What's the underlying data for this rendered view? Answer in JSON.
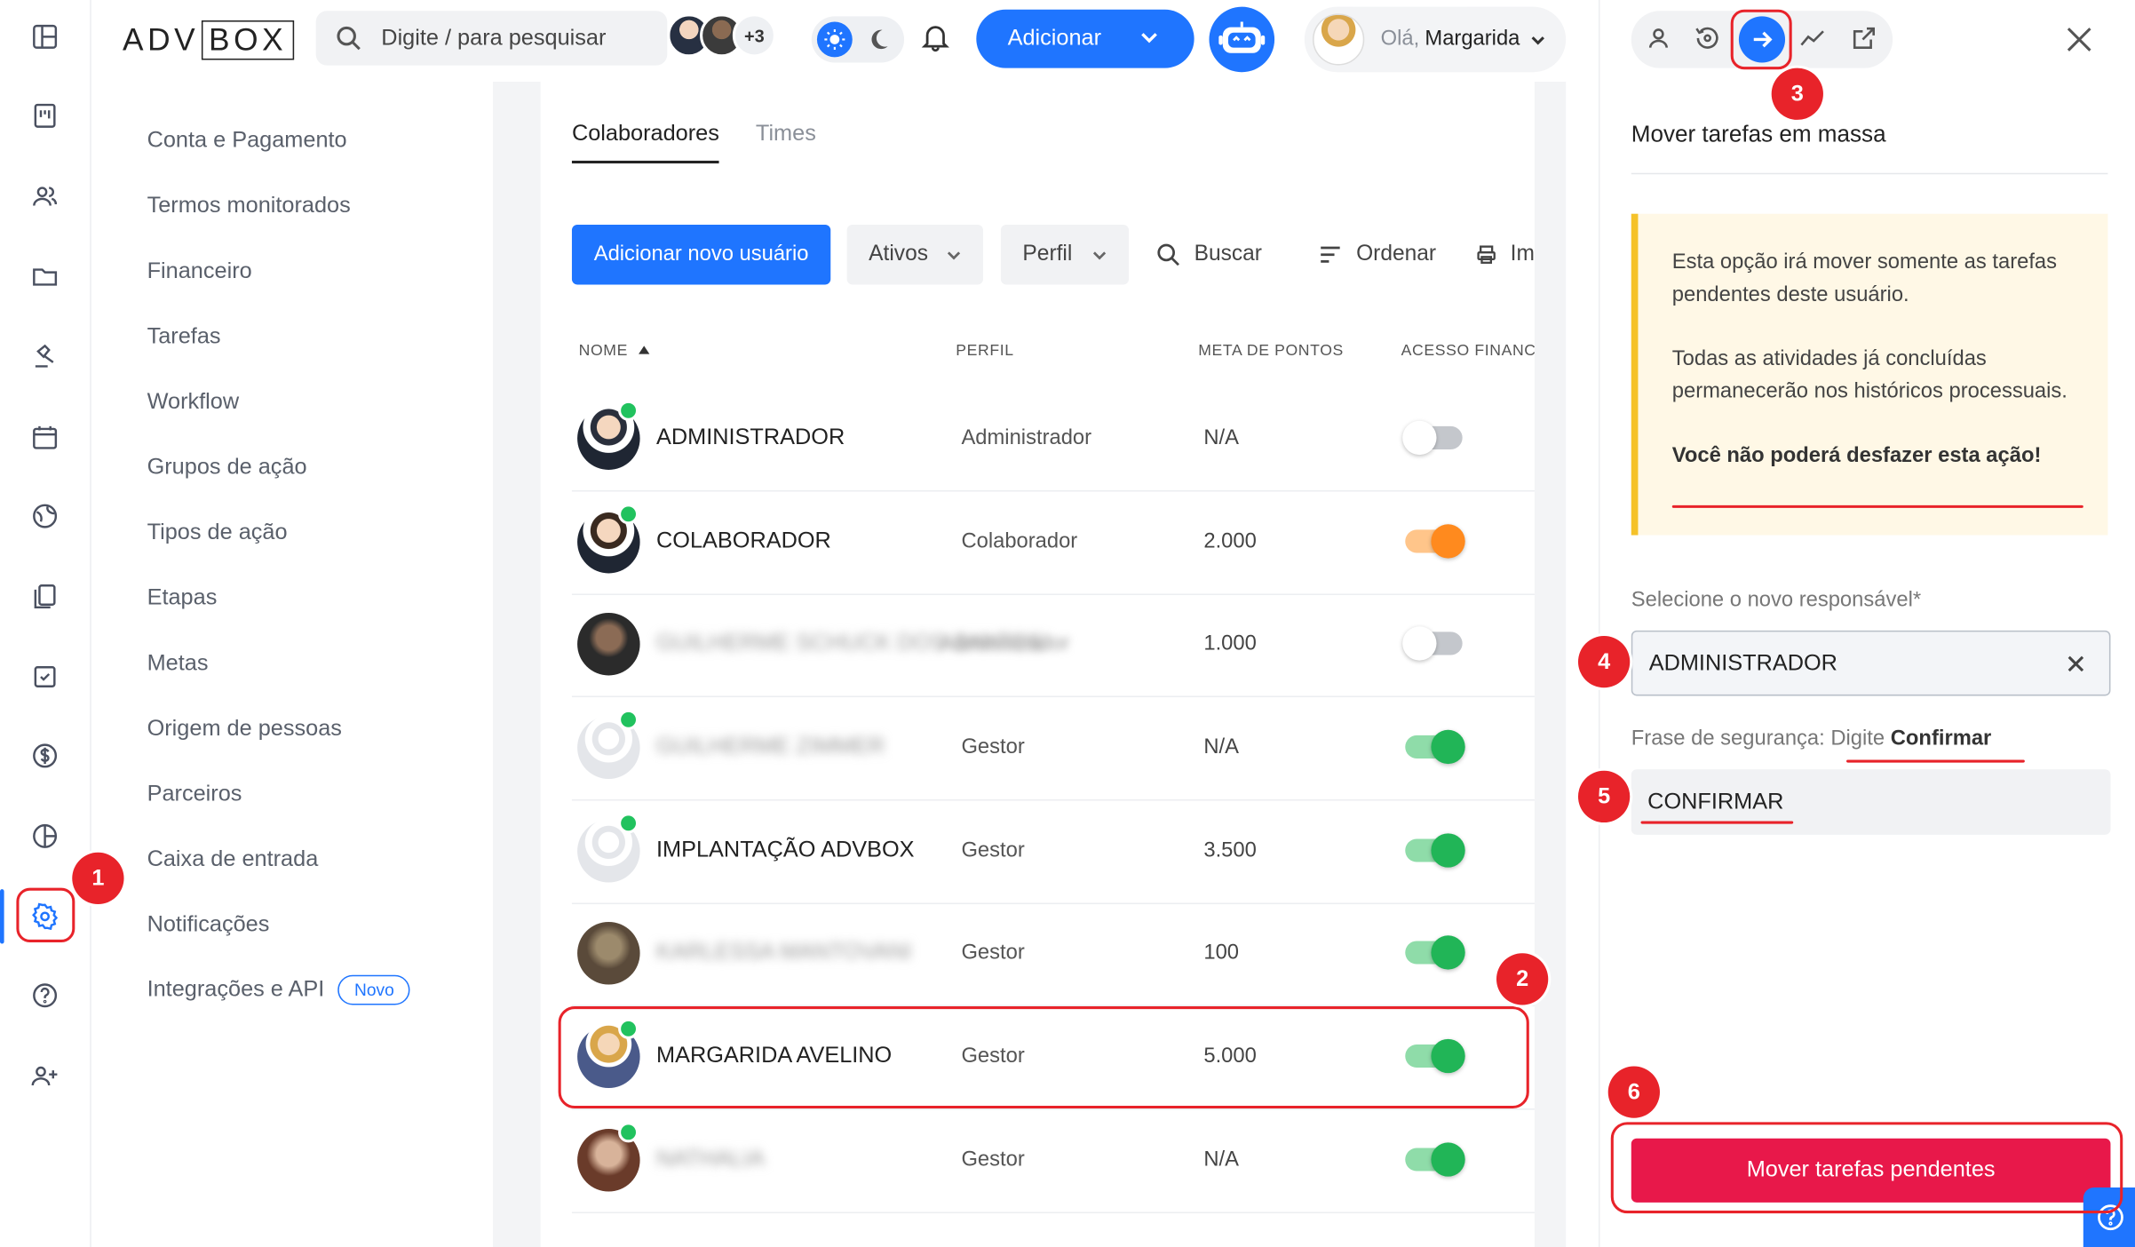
{
  "header": {
    "logo_left": "ADV",
    "logo_box": "BOX",
    "search_placeholder": "Digite / para pesquisar",
    "avatars_more": "+3",
    "add_button": "Adicionar",
    "user_greeting": "Olá,",
    "user_name": "Margarida"
  },
  "submenu": {
    "items": [
      "Conta e Pagamento",
      "Termos monitorados",
      "Financeiro",
      "Tarefas",
      "Workflow",
      "Grupos de ação",
      "Tipos de ação",
      "Etapas",
      "Metas",
      "Origem de pessoas",
      "Parceiros",
      "Caixa de entrada",
      "Notificações",
      "Integrações e API"
    ],
    "new_badge": "Novo"
  },
  "tabs": [
    "Colaboradores",
    "Times"
  ],
  "toolbar": {
    "add_user": "Adicionar novo usuário",
    "filter_active": "Ativos",
    "filter_profile": "Perfil",
    "search": "Buscar",
    "sort": "Ordenar",
    "print": "Im"
  },
  "table": {
    "columns": [
      "NOME",
      "PERFIL",
      "META DE PONTOS",
      "ACESSO FINANCE"
    ],
    "rows": [
      {
        "name": "ADMINISTRADOR",
        "profile": "Administrador",
        "points": "N/A",
        "finance": "off",
        "blurred": false
      },
      {
        "name": "COLABORADOR",
        "profile": "Colaborador",
        "points": "2.000",
        "finance": "orange",
        "blurred": false
      },
      {
        "name": "GUILHERME SCHUCK DOS SANTOS",
        "profile": "Administrador",
        "points": "1.000",
        "finance": "off",
        "blurred": true
      },
      {
        "name": "GUILHERME ZIMMER",
        "profile": "Gestor",
        "points": "N/A",
        "finance": "green",
        "blurred": true
      },
      {
        "name": "IMPLANTAÇÃO ADVBOX",
        "profile": "Gestor",
        "points": "3.500",
        "finance": "green",
        "blurred": false
      },
      {
        "name": "KARLESSA MANTOVANI",
        "profile": "Gestor",
        "points": "100",
        "finance": "green",
        "blurred": true
      },
      {
        "name": "MARGARIDA AVELINO",
        "profile": "Gestor",
        "points": "5.000",
        "finance": "green",
        "blurred": false
      },
      {
        "name": "NATHALIA",
        "profile": "Gestor",
        "points": "N/A",
        "finance": "green",
        "blurred": true
      }
    ]
  },
  "panel": {
    "title": "Mover tarefas em massa",
    "warning_p1": "Esta opção irá mover somente as tarefas pendentes deste usuário.",
    "warning_p2": "Todas as atividades já concluídas permanecerão nos históricos processuais.",
    "warning_p3": "Você não poderá desfazer esta ação!",
    "select_label": "Selecione o novo responsável*",
    "select_value": "ADMINISTRADOR",
    "phrase_label": "Frase de segurança:",
    "phrase_hint_prefix": "Digite",
    "phrase_hint_word": "Confirmar",
    "phrase_value": "CONFIRMAR",
    "submit": "Mover tarefas pendentes"
  },
  "annotations": [
    "1",
    "2",
    "3",
    "4",
    "5",
    "6"
  ],
  "colors": {
    "primary": "#1f75ff",
    "danger": "#e8184a",
    "annotation": "#e8232a",
    "warning_bg": "#fff8e6",
    "warning_border": "#f5c22a",
    "online": "#21c25e"
  }
}
